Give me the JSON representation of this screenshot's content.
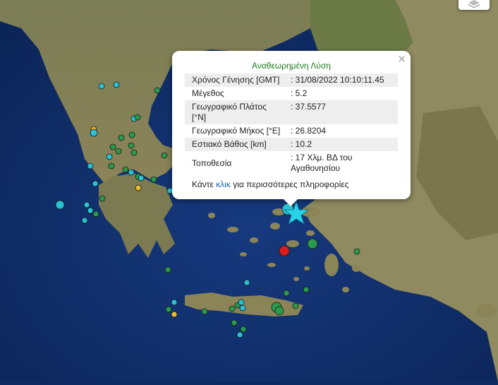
{
  "popup": {
    "title": "Αναθεωρημένη Λύση",
    "close": "×",
    "rows": [
      {
        "label": "Χρόνος Γένησης [GMT]",
        "value": ": 31/08/2022 10:10:11.45"
      },
      {
        "label": "Μέγεθος",
        "value": ": 5.2"
      },
      {
        "label": "Γεωγραφικό Πλάτος [°N]",
        "value": ": 37.5577"
      },
      {
        "label": "Γεωγραφικό Μήκος [°E]",
        "value": ": 26.8204"
      },
      {
        "label": "Εστιακό Βάθος [km]",
        "value": ": 10.2"
      },
      {
        "label": "Τοποθεσία",
        "value": ": 17 Χλμ. ΒΔ του Αγαθονησίου"
      }
    ],
    "more_prefix": "Κάντε ",
    "more_link": "κλικ",
    "more_suffix": " για περισσότερες πληροφορίες"
  },
  "map": {
    "colors": {
      "sea": "#13357a",
      "deep_sea": "#0b2459",
      "land": "#8a8659",
      "mountain": "#6f6a44",
      "greenland": "#5f7a43"
    },
    "markers": {
      "main_event": {
        "type": "star",
        "color": "#28d2e6"
      },
      "red": "#e01b1b",
      "green": "#2a9a4c",
      "cyan": "#29c3d6",
      "yellow": "#e8c030"
    },
    "layer_button_icon": "layers-icon"
  }
}
